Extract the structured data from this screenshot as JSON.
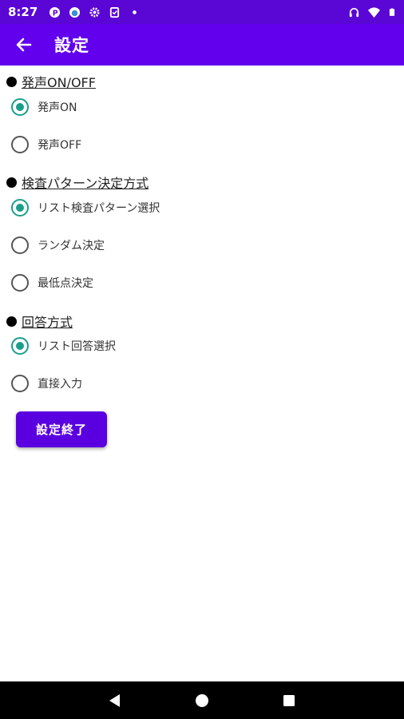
{
  "status_bar": {
    "time": "8:27",
    "left_icons": [
      "p-icon",
      "cloud-icon",
      "gear-icon",
      "clipboard-icon",
      "dot-icon"
    ],
    "right_icons": [
      "headphones-icon",
      "wifi-icon",
      "battery-icon"
    ]
  },
  "app_bar": {
    "title": "設定",
    "back_icon": "arrow-left-icon"
  },
  "sections": [
    {
      "header": "発声ON/OFF",
      "options": [
        {
          "label": "発声ON",
          "checked": true
        },
        {
          "label": "発声OFF",
          "checked": false
        }
      ]
    },
    {
      "header": "検査パターン決定方式",
      "options": [
        {
          "label": "リスト検査パターン選択",
          "checked": true
        },
        {
          "label": "ランダム決定",
          "checked": false
        },
        {
          "label": "最低点決定",
          "checked": false
        }
      ]
    },
    {
      "header": "回答方式",
      "options": [
        {
          "label": "リスト回答選択",
          "checked": true
        },
        {
          "label": "直接入力",
          "checked": false
        }
      ]
    }
  ],
  "finish_button": {
    "label": "設定終了"
  },
  "colors": {
    "status_bar": "#5a06d4",
    "app_bar": "#6200ee",
    "radio_accent": "#1a9e8c",
    "button": "#5a00e0"
  },
  "nav_bar": {
    "buttons": [
      "back-triangle-icon",
      "home-circle-icon",
      "recents-square-icon"
    ]
  }
}
